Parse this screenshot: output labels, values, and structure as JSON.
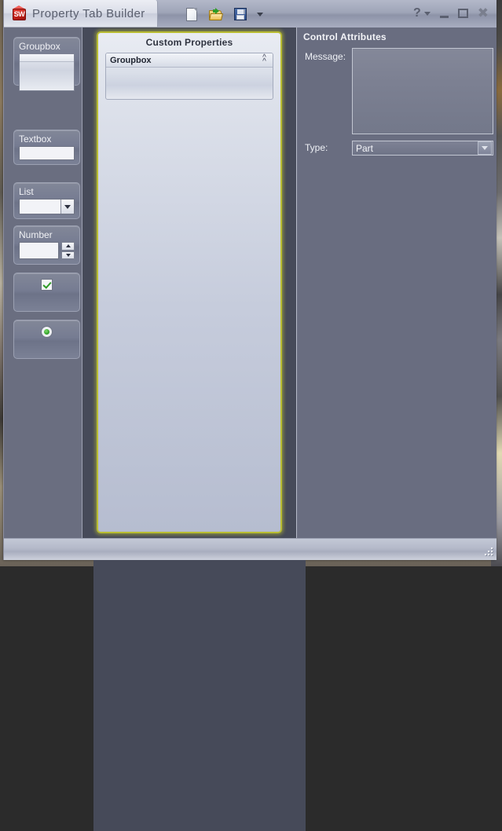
{
  "window": {
    "title": "Property Tab Builder",
    "logo_text": "SW",
    "logo_name": "solidworks-cube-icon"
  },
  "toolbar": {
    "new_label": "New",
    "open_label": "Open",
    "save_label": "Save",
    "save_dropdown_label": "Save options"
  },
  "system_buttons": {
    "help_label": "?",
    "help_menu_label": "Help menu",
    "minimize_label": "Minimize",
    "maximize_label": "Maximize",
    "close_label": "Close"
  },
  "toolbox": {
    "items": [
      {
        "label": "Groupbox",
        "kind": "groupbox"
      },
      {
        "label": "Textbox",
        "kind": "textbox"
      },
      {
        "label": "List",
        "kind": "list"
      },
      {
        "label": "Number",
        "kind": "number"
      },
      {
        "label": "Checkbox",
        "kind": "checkbox"
      },
      {
        "label": "Radio",
        "kind": "radio"
      }
    ]
  },
  "custom_properties": {
    "title": "Custom Properties",
    "border_color": "#b9bd33",
    "items": [
      {
        "label": "Groupbox",
        "collapse_icon": "double-chevron-up"
      }
    ]
  },
  "control_attributes": {
    "title": "Control Attributes",
    "message": {
      "label": "Message:",
      "value": ""
    },
    "type": {
      "label": "Type:",
      "value": "Part"
    }
  },
  "statusbar": {
    "text": "",
    "grip_label": "Resize grip"
  }
}
